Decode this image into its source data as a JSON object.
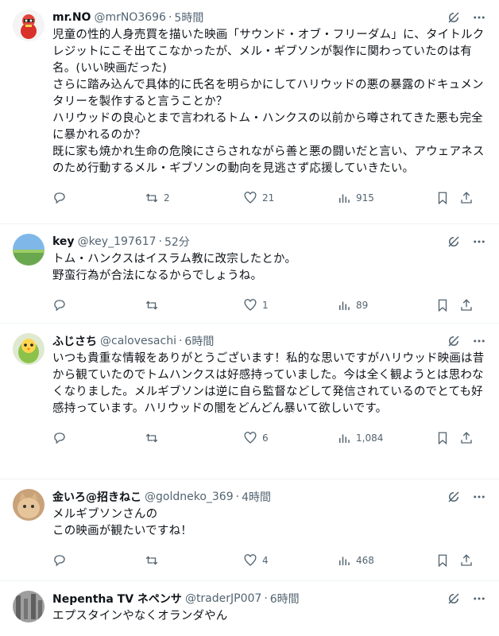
{
  "posts": [
    {
      "name": "mr.NO",
      "handle": "@mrNO3696",
      "time": "5時間",
      "text": "児童の性的人身売買を描いた映画「サウンド・オブ・フリーダム」に、タイトルクレジットにこそ出てこなかったが、メル・ギブソンが製作に関わっていたのは有名。(いい映画だった)\nさらに踏み込んで具体的に氏名を明らかにしてハリウッドの悪の暴露のドキュメンタリーを製作すると言うことか？\nハリウッドの良心とまで言われるトム・ハンクスの以前から噂されてきた悪も完全に暴かれるのか？\n既に家も焼かれ生命の危険にさらされながら善と悪の闘いだと言い、アウェアネスのため行動するメル・ギブソンの動向を見逃さず応援していきたい。",
      "replies": "",
      "reposts": "2",
      "likes": "21",
      "views": "915"
    },
    {
      "name": "key",
      "handle": "@key_197617",
      "time": "52分",
      "text": "トム・ハンクスはイスラム教に改宗したとか。\n野蛮行為が合法になるからでしょうね。",
      "replies": "",
      "reposts": "",
      "likes": "1",
      "views": "89"
    },
    {
      "name": "ふじさち",
      "handle": "@calovesachi",
      "time": "6時間",
      "text": "いつも貴重な情報をありがとうございます！私的な思いですがハリウッド映画は昔から観ていたのでトムハンクスは好感持っていました。今は全く観ようとは思わなくなりました。メルギブソンは逆に自ら監督などして発信されているのでとても好感持っています。ハリウッドの闇をどんどん暴いて欲しいです。",
      "replies": "",
      "reposts": "",
      "likes": "6",
      "views": "1,084"
    },
    {
      "name": "金いろ@招きねこ",
      "handle": "@goldneko_369",
      "time": "4時間",
      "text": "メルギブソンさんの\nこの映画が観たいですね！",
      "replies": "",
      "reposts": "",
      "likes": "4",
      "views": "468"
    },
    {
      "name": "Nepentha TV ネペンサ",
      "handle": "@traderJP007",
      "time": "6時間",
      "text": "エプスタインやなくオランダやん",
      "replies": "",
      "reposts": "",
      "likes": "",
      "views": ""
    }
  ],
  "icons": {
    "grok": "grok-icon",
    "more": "more-icon",
    "reply": "reply-icon",
    "repost": "repost-icon",
    "like": "like-icon",
    "views": "views-icon",
    "bookmark": "bookmark-icon",
    "share": "share-icon"
  },
  "colors": {
    "text": "#0f1419",
    "secondary": "#536471",
    "border": "#eff3f4"
  }
}
